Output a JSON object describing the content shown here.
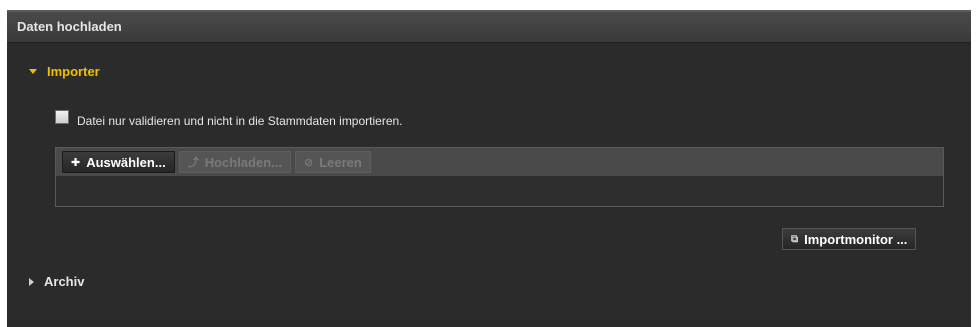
{
  "panel": {
    "title": "Daten hochladen"
  },
  "importer": {
    "label": "Importer",
    "validate_label": "Datei nur validieren und nicht in die Stammdaten importieren.",
    "toolbar": {
      "select_label": "Auswählen...",
      "upload_label": "Hochladen...",
      "clear_label": "Leeren"
    },
    "importmonitor_label": "Importmonitor ..."
  },
  "archiv": {
    "label": "Archiv"
  },
  "icons": {
    "expanded": "triangle-down-icon",
    "collapsed": "triangle-right-icon",
    "select": "plus-icon",
    "upload": "upload-arrow-icon",
    "clear": "no-entry-icon",
    "monitor": "external-link-icon"
  },
  "colors": {
    "panel_bg": "#2b2b2b",
    "header_bg": "#404040",
    "accent": "#f0c000",
    "text": "#e6e6e6",
    "disabled_text": "#7a7a7a"
  }
}
